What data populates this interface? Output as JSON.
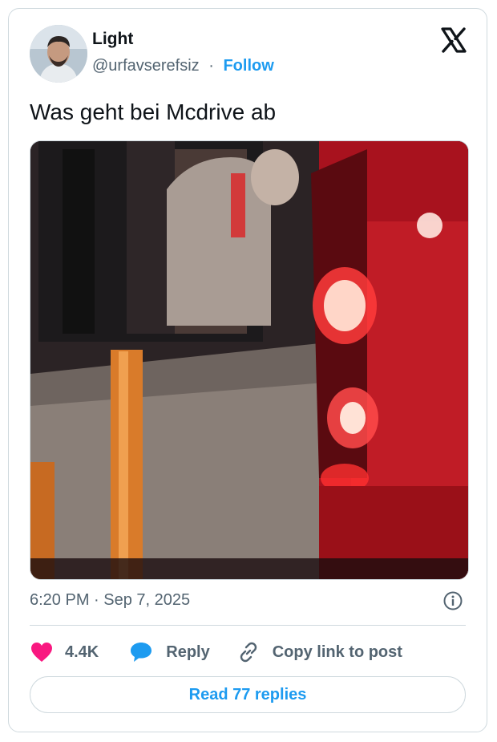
{
  "author": {
    "name": "Light",
    "handle": "@urfavserefsiz",
    "separator": "·",
    "follow_label": "Follow"
  },
  "brand_icon": "x-logo-icon",
  "tweet": {
    "text": "Was geht bei Mcdrive ab",
    "timestamp": "6:20 PM · Sep 7, 2025"
  },
  "actions": {
    "like_count": "4.4K",
    "reply_label": "Reply",
    "copy_link_label": "Copy link to post"
  },
  "read_replies_label": "Read 77 replies",
  "colors": {
    "accent": "#1d9bf0",
    "like": "#f91880",
    "muted": "#536471",
    "border": "#cfd9de"
  },
  "icons": [
    "x-logo-icon",
    "info-icon",
    "heart-icon",
    "reply-bubble-icon",
    "link-icon"
  ]
}
